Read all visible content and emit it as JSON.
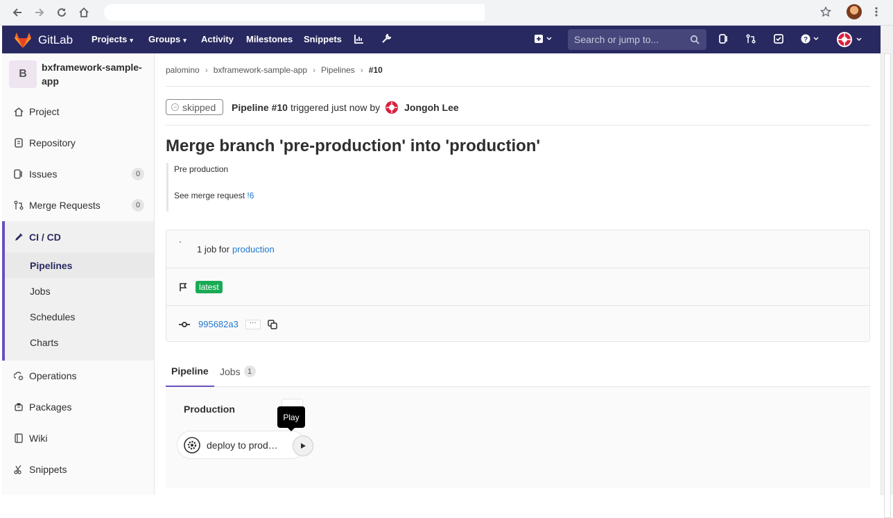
{
  "colors": {
    "header_bg": "#292961",
    "link": "#1f78d1",
    "accent": "#6b4fbb",
    "success": "#1aaa55"
  },
  "header": {
    "brand": "GitLab",
    "menus": [
      "Projects",
      "Groups",
      "Activity",
      "Milestones",
      "Snippets"
    ],
    "search_placeholder": "Search or jump to..."
  },
  "sidebar": {
    "project_avatar_letter": "B",
    "project_name": "bxframework-sample-app",
    "items": [
      {
        "label": "Project",
        "icon": "home-icon"
      },
      {
        "label": "Repository",
        "icon": "doc-icon"
      },
      {
        "label": "Issues",
        "icon": "issues-icon",
        "badge": "0"
      },
      {
        "label": "Merge Requests",
        "icon": "merge-request-icon",
        "badge": "0"
      },
      {
        "label": "CI / CD",
        "icon": "rocket-icon"
      },
      {
        "label": "Operations",
        "icon": "cloud-gear-icon"
      },
      {
        "label": "Packages",
        "icon": "package-icon"
      },
      {
        "label": "Wiki",
        "icon": "book-icon"
      },
      {
        "label": "Snippets",
        "icon": "scissors-icon"
      }
    ],
    "cicd_sub": [
      "Pipelines",
      "Jobs",
      "Schedules",
      "Charts"
    ]
  },
  "breadcrumb": [
    "palomino",
    "bxframework-sample-app",
    "Pipelines",
    "#10"
  ],
  "pipeline": {
    "status": "skipped",
    "title": "Pipeline #10",
    "triggered_text": "triggered just now by",
    "user": "Jongoh Lee"
  },
  "commit": {
    "title": "Merge branch 'pre-production' into 'production'",
    "desc_line1": "Pre production",
    "desc_line2_prefix": "See merge request",
    "mr_link": "!6"
  },
  "info": {
    "jobs_text": "1 job for",
    "branch": "production",
    "tag": "latest",
    "sha": "995682a3"
  },
  "tabs": {
    "pipeline": "Pipeline",
    "jobs": "Jobs",
    "jobs_count": "1"
  },
  "graph": {
    "stage": "Production",
    "job": "deploy to production",
    "tooltip": "Play"
  }
}
